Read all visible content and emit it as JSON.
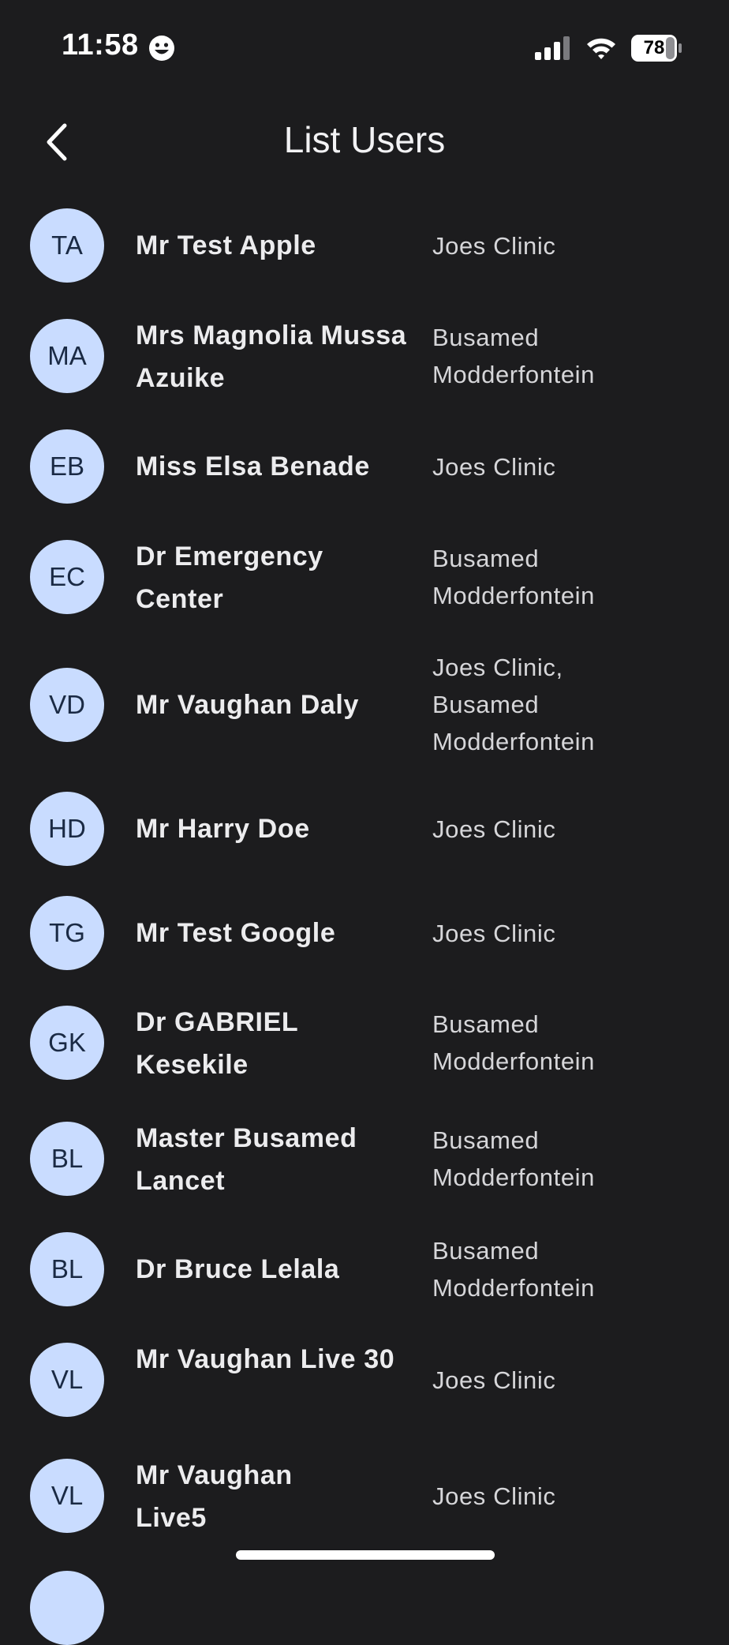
{
  "status_bar": {
    "time": "11:58",
    "battery": "78"
  },
  "header": {
    "title": "List Users"
  },
  "users": [
    {
      "initials": "TA",
      "name": "Mr Test Apple",
      "clinic": "Joes Clinic"
    },
    {
      "initials": "MA",
      "name": "Mrs Magnolia Mussa Azuike",
      "clinic": "Busamed Modderfontein"
    },
    {
      "initials": "EB",
      "name": "Miss Elsa Benade",
      "clinic": "Joes Clinic"
    },
    {
      "initials": "EC",
      "name": "Dr Emergency Center",
      "clinic": "Busamed Modderfontein"
    },
    {
      "initials": "VD",
      "name": "Mr Vaughan Daly",
      "clinic": "Joes Clinic, Busamed Modderfontein"
    },
    {
      "initials": "HD",
      "name": "Mr Harry Doe",
      "clinic": "Joes Clinic"
    },
    {
      "initials": "TG",
      "name": "Mr Test Google",
      "clinic": "Joes Clinic"
    },
    {
      "initials": "GK",
      "name": "Dr GABRIEL Kesekile",
      "clinic": "Busamed Modderfontein"
    },
    {
      "initials": "BL",
      "name": "Master Busamed Lancet",
      "clinic": "Busamed Modderfontein"
    },
    {
      "initials": "BL",
      "name": "Dr Bruce Lelala",
      "clinic": "Busamed Modderfontein"
    },
    {
      "initials": "VL",
      "name": "Mr Vaughan Live 30",
      "clinic": "Joes Clinic"
    },
    {
      "initials": "VL",
      "name": "Mr Vaughan Live5",
      "clinic": "Joes Clinic"
    }
  ]
}
